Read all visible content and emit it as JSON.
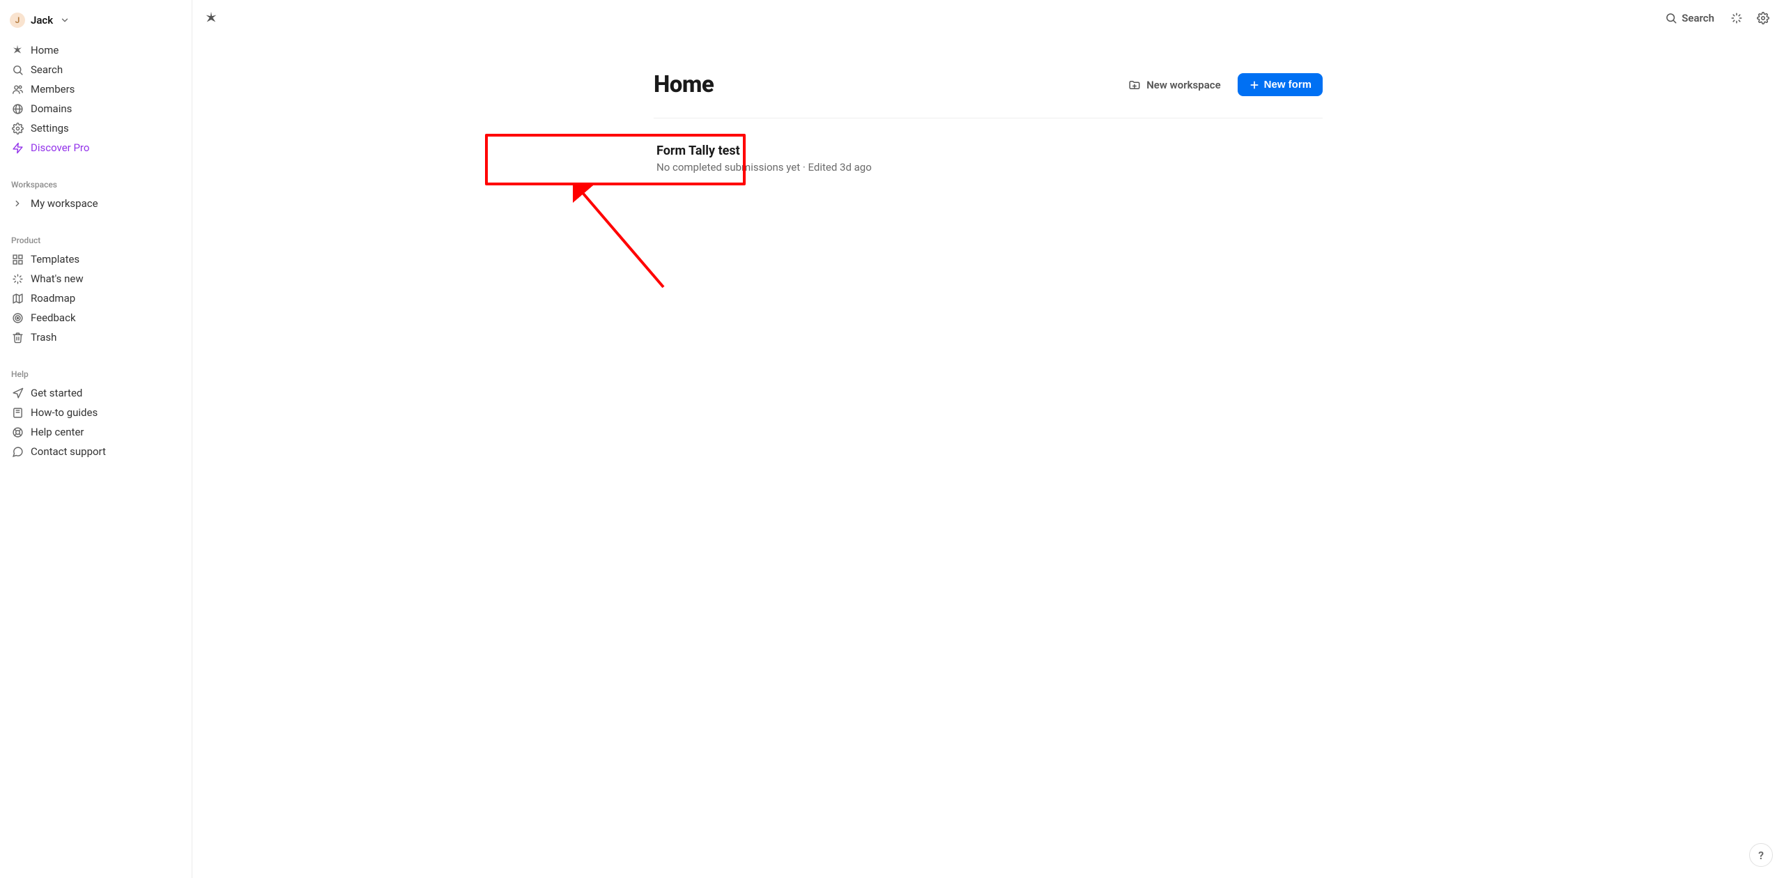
{
  "user": {
    "initial": "J",
    "name": "Jack"
  },
  "sidebar": {
    "nav": [
      {
        "label": "Home"
      },
      {
        "label": "Search"
      },
      {
        "label": "Members"
      },
      {
        "label": "Domains"
      },
      {
        "label": "Settings"
      },
      {
        "label": "Discover Pro"
      }
    ],
    "workspaces_heading": "Workspaces",
    "workspaces": [
      {
        "label": "My workspace"
      }
    ],
    "product_heading": "Product",
    "product": [
      {
        "label": "Templates"
      },
      {
        "label": "What's new"
      },
      {
        "label": "Roadmap"
      },
      {
        "label": "Feedback"
      },
      {
        "label": "Trash"
      }
    ],
    "help_heading": "Help",
    "help": [
      {
        "label": "Get started"
      },
      {
        "label": "How-to guides"
      },
      {
        "label": "Help center"
      },
      {
        "label": "Contact support"
      }
    ]
  },
  "topbar": {
    "search_label": "Search"
  },
  "page": {
    "title": "Home",
    "new_workspace_label": "New workspace",
    "new_form_label": "New form"
  },
  "form": {
    "title": "Form Tally test",
    "meta": "No completed submissions yet · Edited 3d ago"
  },
  "help_fab": "?"
}
